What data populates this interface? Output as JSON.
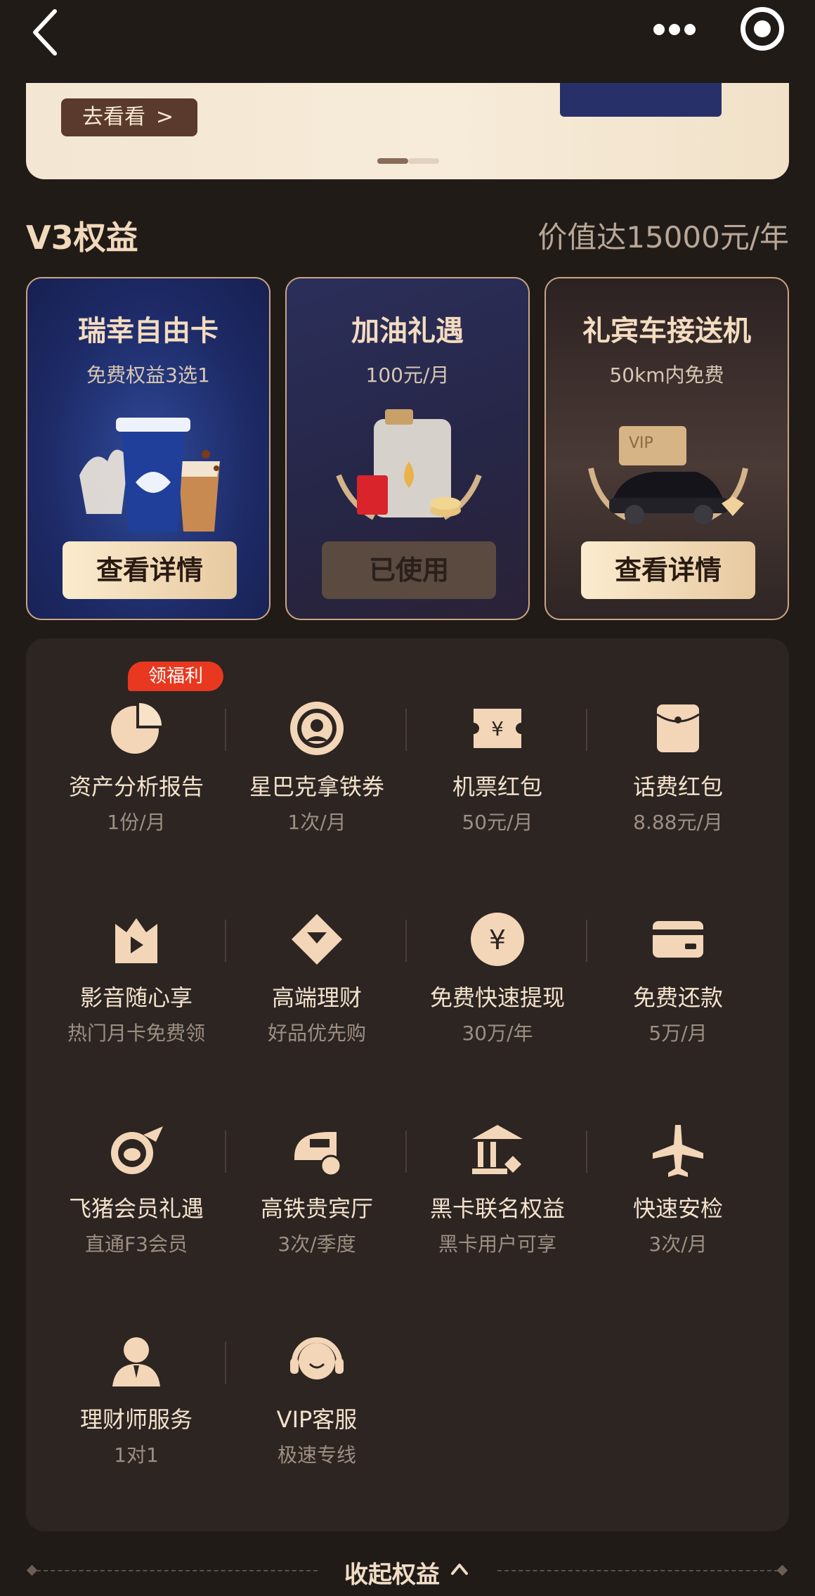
{
  "banner": {
    "button_label": "去看看",
    "button_arrow": ">"
  },
  "section": {
    "title": "V3权益",
    "value": "价值达15000元/年"
  },
  "cards": [
    {
      "title": "瑞幸自由卡",
      "subtitle": "免费权益3选1",
      "button": "查看详情",
      "state": "available",
      "icon": "coffee-icon"
    },
    {
      "title": "加油礼遇",
      "subtitle": "100元/月",
      "button": "已使用",
      "state": "used",
      "icon": "fuel-icon"
    },
    {
      "title": "礼宾车接送机",
      "subtitle": "50km内免费",
      "button": "查看详情",
      "state": "available",
      "icon": "car-icon",
      "badge": "VIP"
    }
  ],
  "benefits": {
    "promo_tag": "领福利",
    "items": [
      {
        "title": "资产分析报告",
        "subtitle": "1份/月",
        "icon": "pie-chart-icon"
      },
      {
        "title": "星巴克拿铁券",
        "subtitle": "1次/月",
        "icon": "starbucks-icon"
      },
      {
        "title": "机票红包",
        "subtitle": "50元/月",
        "icon": "ticket-icon"
      },
      {
        "title": "话费红包",
        "subtitle": "8.88元/月",
        "icon": "red-envelope-icon"
      },
      {
        "title": "影音随心享",
        "subtitle": "热门月卡免费领",
        "icon": "play-crown-icon"
      },
      {
        "title": "高端理财",
        "subtitle": "好品优先购",
        "icon": "diamond-icon"
      },
      {
        "title": "免费快速提现",
        "subtitle": "30万/年",
        "icon": "yen-coin-icon"
      },
      {
        "title": "免费还款",
        "subtitle": "5万/月",
        "icon": "card-icon"
      },
      {
        "title": "飞猪会员礼遇",
        "subtitle": "直通F3会员",
        "icon": "fliggy-icon"
      },
      {
        "title": "高铁贵宾厅",
        "subtitle": "3次/季度",
        "icon": "train-icon"
      },
      {
        "title": "黑卡联名权益",
        "subtitle": "黑卡用户可享",
        "icon": "bank-icon"
      },
      {
        "title": "快速安检",
        "subtitle": "3次/月",
        "icon": "plane-icon"
      },
      {
        "title": "理财师服务",
        "subtitle": "1对1",
        "icon": "advisor-icon"
      },
      {
        "title": "VIP客服",
        "subtitle": "极速专线",
        "icon": "headset-icon"
      }
    ]
  },
  "collapse": {
    "label": "收起权益"
  },
  "colors": {
    "background": "#211b18",
    "panel": "#2c2522",
    "gold": "#e7c9a0",
    "tag_red": "#e8381f"
  }
}
